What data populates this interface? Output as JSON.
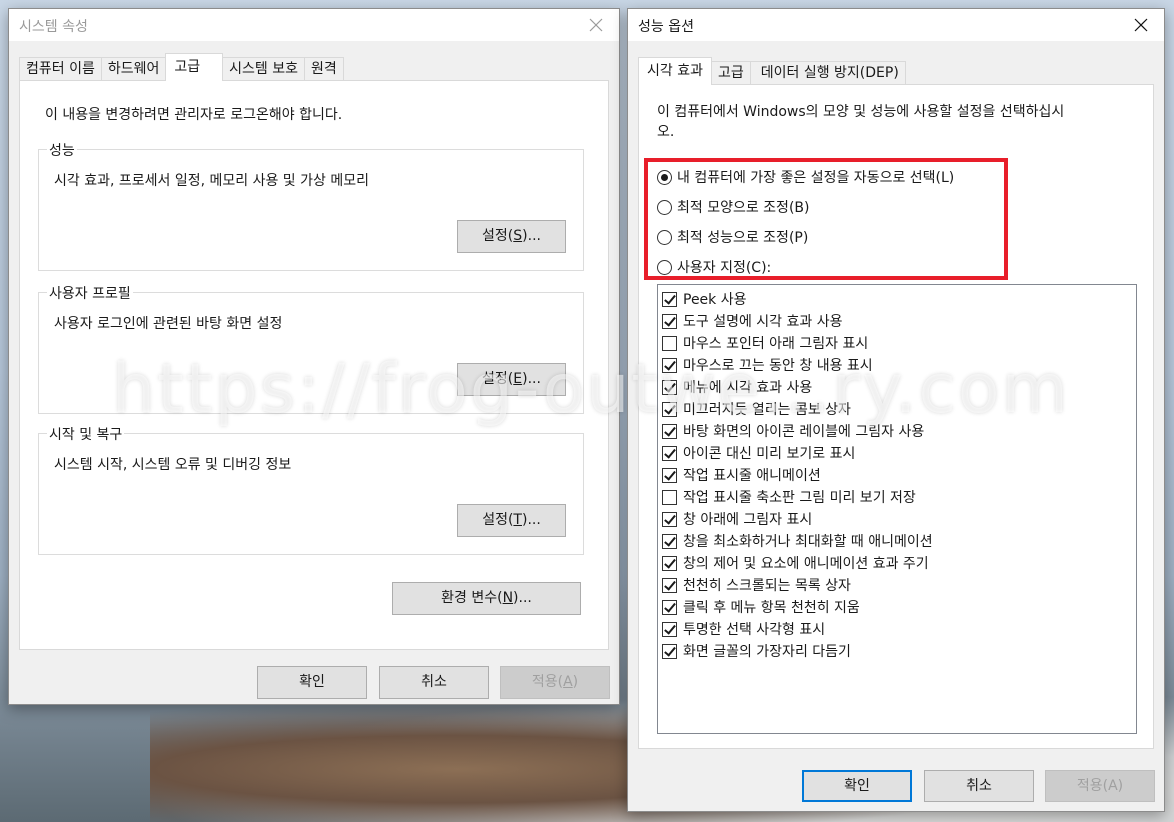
{
  "watermark": "https://frog-outwe...ry.com",
  "system_properties": {
    "title": "시스템 속성",
    "tabs": [
      "컴퓨터 이름",
      "하드웨어",
      "고급",
      "시스템 보호",
      "원격"
    ],
    "active_tab": "고급",
    "admin_notice": "이 내용을 변경하려면 관리자로 로그온해야 합니다.",
    "performance": {
      "title": "성능",
      "description": "시각 효과, 프로세서 일정, 메모리 사용 및 가상 메모리",
      "button_prefix": "설정(",
      "button_key": "S",
      "button_suffix": ")..."
    },
    "user_profiles": {
      "title": "사용자 프로필",
      "description": "사용자 로그인에 관련된 바탕 화면 설정",
      "button_prefix": "설정(",
      "button_key": "E",
      "button_suffix": ")..."
    },
    "startup_recovery": {
      "title": "시작 및 복구",
      "description": "시스템 시작, 시스템 오류 및 디버깅 정보",
      "button_prefix": "설정(",
      "button_key": "T",
      "button_suffix": ")..."
    },
    "env_button": {
      "prefix": "환경 변수(",
      "key": "N",
      "suffix": ")..."
    },
    "ok": "확인",
    "cancel": "취소",
    "apply_prefix": "적용(",
    "apply_key": "A",
    "apply_suffix": ")"
  },
  "performance_options": {
    "title": "성능 옵션",
    "tabs": [
      "시각 효과",
      "고급",
      "데이터 실행 방지(DEP)"
    ],
    "active_tab": "시각 효과",
    "description": "이 컴퓨터에서 Windows의 모양 및 성능에 사용할 설정을 선택하십시오.",
    "description_line1": "이 컴퓨터에서 Windows의 모양 및 성능에 사용할 설정을 선택하십시",
    "description_line2": "오.",
    "radios": [
      {
        "label": "내 컴퓨터에 가장 좋은 설정을 자동으로 선택(L)",
        "checked": true
      },
      {
        "label": "최적 모양으로 조정(B)",
        "checked": false
      },
      {
        "label": "최적 성능으로 조정(P)",
        "checked": false
      },
      {
        "label": "사용자 지정(C):",
        "checked": false
      }
    ],
    "effects": [
      {
        "label": "Peek 사용",
        "checked": true
      },
      {
        "label": "도구 설명에 시각 효과 사용",
        "checked": true
      },
      {
        "label": "마우스 포인터 아래 그림자 표시",
        "checked": false
      },
      {
        "label": "마우스로 끄는 동안 창 내용 표시",
        "checked": true
      },
      {
        "label": "메뉴에 시각 효과 사용",
        "checked": true
      },
      {
        "label": "미끄러지듯 열리는 콤보 상자",
        "checked": true
      },
      {
        "label": "바탕 화면의 아이콘 레이블에 그림자 사용",
        "checked": true
      },
      {
        "label": "아이콘 대신 미리 보기로 표시",
        "checked": true
      },
      {
        "label": "작업 표시줄 애니메이션",
        "checked": true
      },
      {
        "label": "작업 표시줄 축소판 그림 미리 보기 저장",
        "checked": false
      },
      {
        "label": "창 아래에 그림자 표시",
        "checked": true
      },
      {
        "label": "창을 최소화하거나 최대화할 때 애니메이션",
        "checked": true
      },
      {
        "label": "창의 제어 및 요소에 애니메이션 효과 주기",
        "checked": true
      },
      {
        "label": "천천히 스크롤되는 목록 상자",
        "checked": true
      },
      {
        "label": "클릭 후 메뉴 항목 천천히 지움",
        "checked": true
      },
      {
        "label": "투명한 선택 사각형 표시",
        "checked": true
      },
      {
        "label": "화면 글꼴의 가장자리 다듬기",
        "checked": true
      }
    ],
    "ok": "확인",
    "cancel": "취소",
    "apply": "적용(A)"
  },
  "colors": {
    "highlight": "#e81e2a",
    "accent": "#0078d7"
  }
}
